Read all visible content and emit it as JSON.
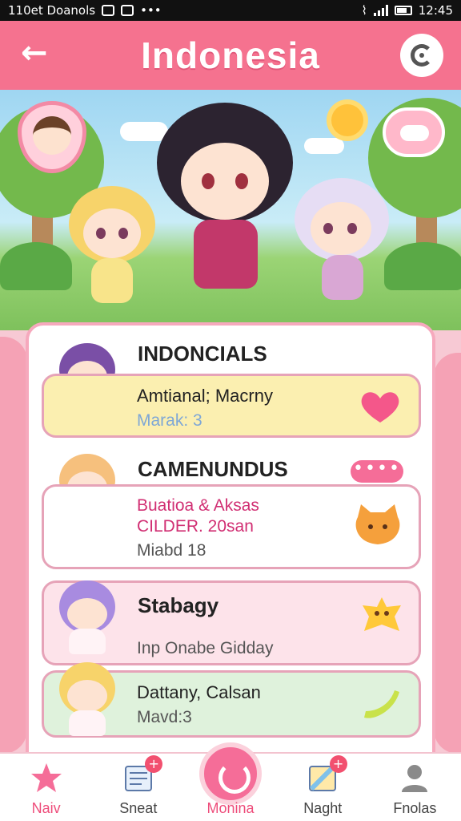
{
  "status_bar": {
    "left_text": "110et Doanols",
    "time": "12:45"
  },
  "header": {
    "title": "Indonesia",
    "back_icon": "arrow-left-icon",
    "action_icon": "refresh-icon"
  },
  "sections": [
    {
      "title": "INDONCIALS",
      "items": [
        {
          "line1": "Amtianal; Macrny",
          "line2": "Marak: 3",
          "badge_icon": "heart-icon",
          "bg": "#fbefb0"
        }
      ]
    },
    {
      "title": "CAMENUNDUS",
      "more_label": "••••",
      "items": [
        {
          "line1": "Buatioa & Aksas",
          "line2": "CILDER. 20san",
          "line3": "Miabd 18",
          "badge_icon": "cat-face-icon",
          "bg": "#ffffff"
        }
      ]
    },
    {
      "title": "Stabagy",
      "items": [
        {
          "line1": "Inp Onabe Gidday",
          "badge_icon": "smiley-star-icon",
          "bg": "#fde3ea"
        },
        {
          "line1": "Dattany, Calsan",
          "line2": "Mavd:3",
          "badge_icon": "banana-icon",
          "bg": "#dff2dc"
        }
      ]
    }
  ],
  "bottom_nav": [
    {
      "label": "Naiv",
      "icon": "star-icon",
      "active": true
    },
    {
      "label": "Sneat",
      "icon": "notes-icon",
      "active": false
    },
    {
      "label": "Monina",
      "icon": "home-swirl-icon",
      "active": true
    },
    {
      "label": "Naght",
      "icon": "image-icon",
      "active": false
    },
    {
      "label": "Fnolas",
      "icon": "user-icon",
      "active": false
    }
  ],
  "colors": {
    "header": "#f5728f",
    "accent": "#f56d98",
    "card_border": "#f6a9bd"
  }
}
